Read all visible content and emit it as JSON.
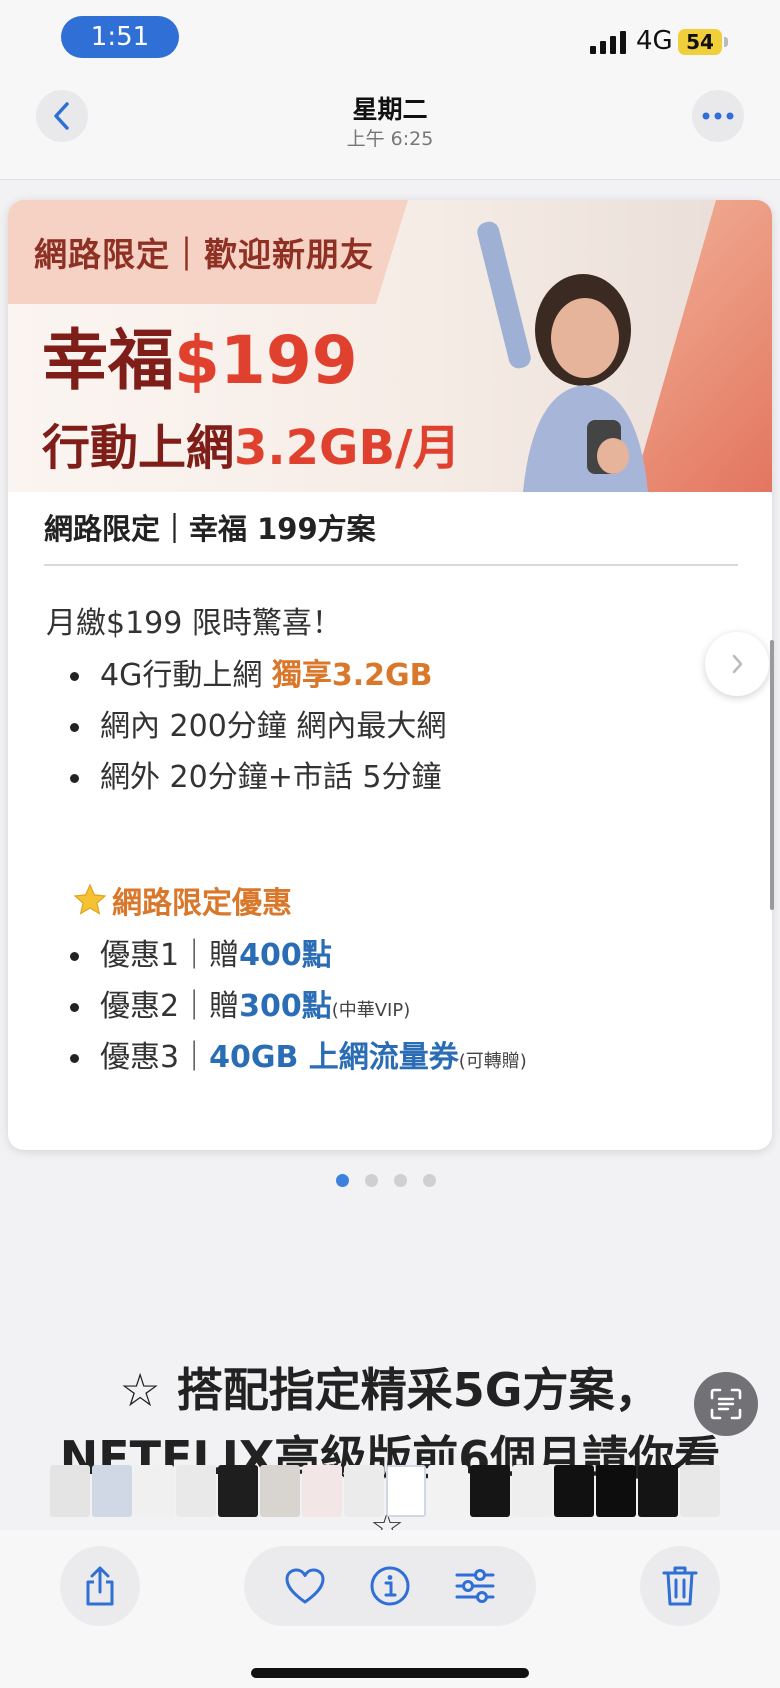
{
  "status_bar": {
    "time": "1:51",
    "network": "4G",
    "battery": "54"
  },
  "nav": {
    "title": "星期二",
    "subtitle": "上午 6:25"
  },
  "card": {
    "banner": {
      "tag": "網路限定｜歡迎新朋友",
      "headline_prefix": "幸福",
      "headline_price": "$199",
      "subline_prefix": "行動上網",
      "subline_data": "3.2GB/月"
    },
    "plan_title": "網路限定｜幸福 199方案",
    "intro": "月繳$199 限時驚喜！",
    "features": [
      {
        "text": "4G行動上網 ",
        "highlight": "獨享3.2GB"
      },
      {
        "text": "網內 200分鐘 網內最大網"
      },
      {
        "text": "網外 20分鐘+市話 5分鐘"
      }
    ],
    "promo_heading": "網路限定優惠",
    "promos": [
      {
        "prefix": "優惠1｜贈",
        "highlight": "400點",
        "note": ""
      },
      {
        "prefix": "優惠2｜贈",
        "highlight": "300點",
        "note": "(中華VIP)"
      },
      {
        "prefix": "優惠3｜",
        "highlight": "40GB 上網流量券",
        "note": "(可轉贈)"
      }
    ]
  },
  "pager": {
    "count": 4,
    "active_index": 0
  },
  "below_card": {
    "line1": "☆ 搭配指定精采5G方案，",
    "line2": "NETFLIX高級版前6個月請你看",
    "star": "☆"
  },
  "toolbar": {
    "share_icon": "share-icon",
    "favorite_icon": "heart-icon",
    "info_icon": "info-icon",
    "adjust_icon": "sliders-icon",
    "delete_icon": "trash-icon"
  },
  "colors": {
    "accent_blue": "#2f6fd6",
    "price_red": "#e0402e",
    "headline_dark_red": "#7f1d18",
    "offer_orange": "#d9772b",
    "offer_blue": "#2a6db5",
    "battery_yellow": "#f0cf3a"
  }
}
